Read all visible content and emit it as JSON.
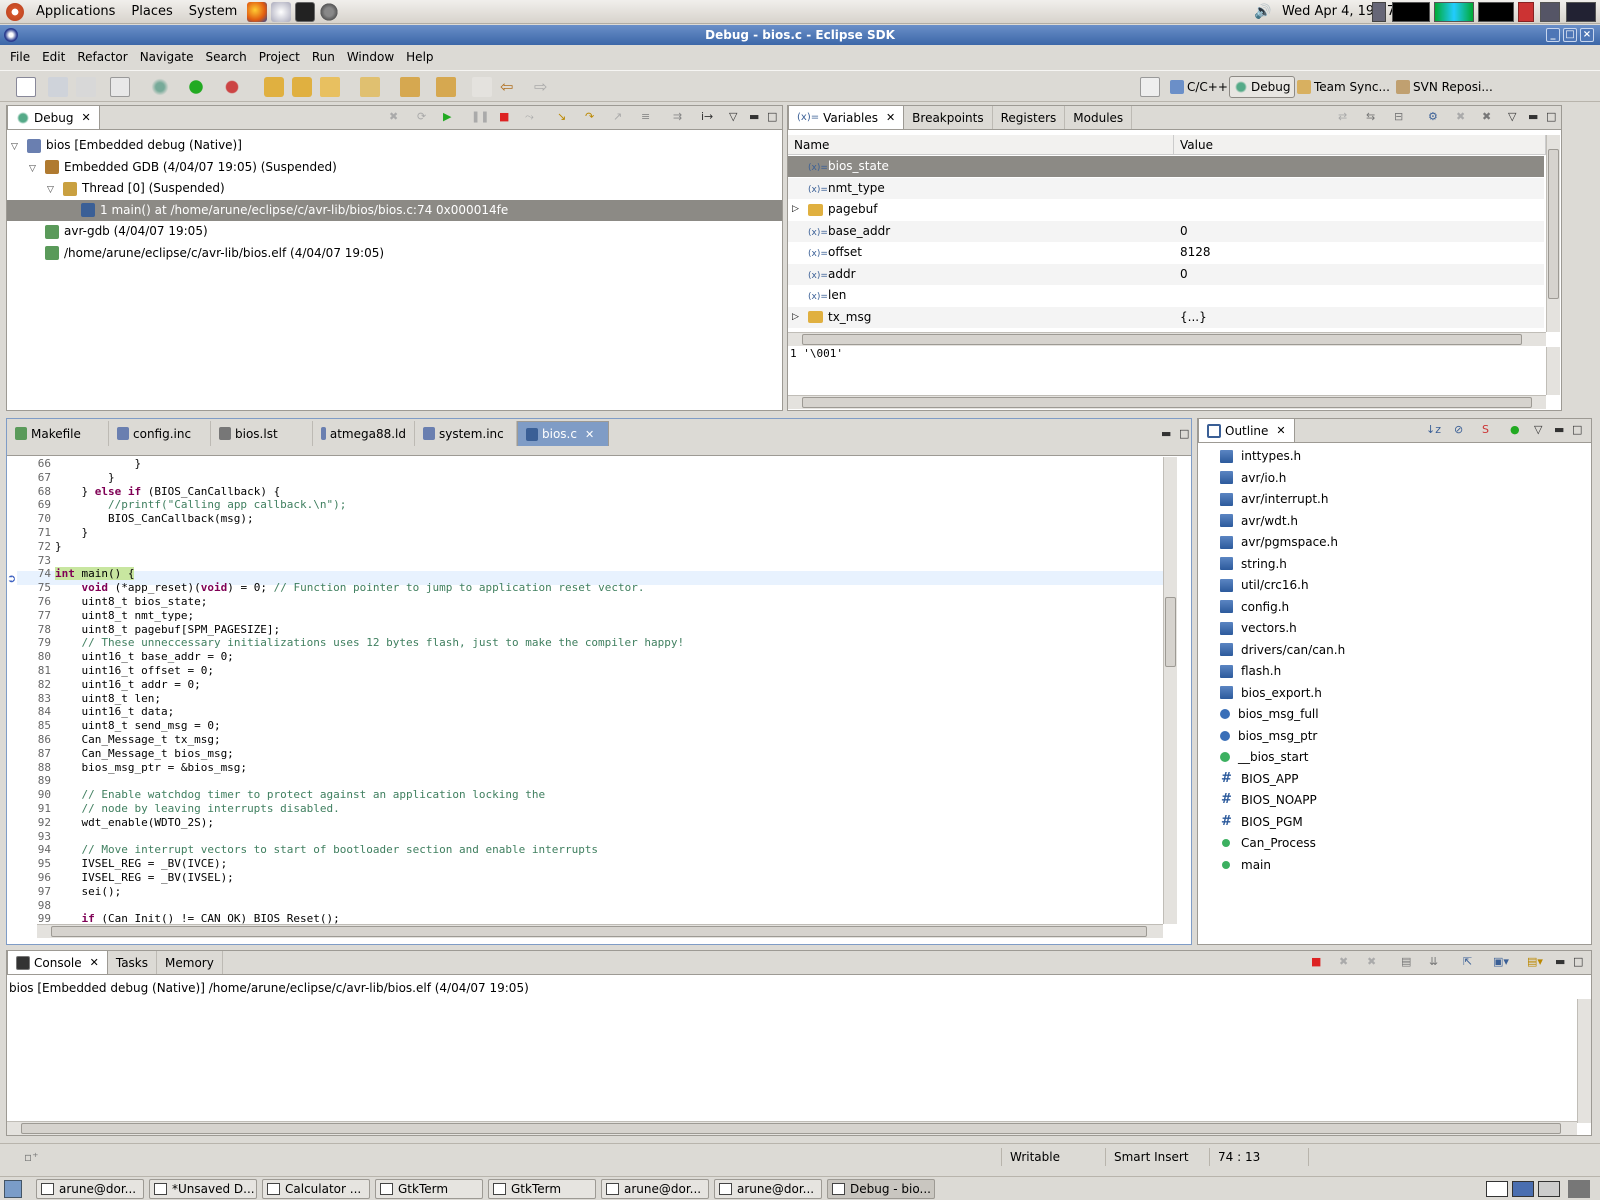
{
  "gnome_panel": {
    "menus": [
      "Applications",
      "Places",
      "System"
    ],
    "clock": "Wed Apr  4, 19:07"
  },
  "window": {
    "title": "Debug - bios.c - Eclipse SDK"
  },
  "menubar": [
    "File",
    "Edit",
    "Refactor",
    "Navigate",
    "Search",
    "Project",
    "Run",
    "Window",
    "Help"
  ],
  "perspectives": [
    {
      "label": "C/C++"
    },
    {
      "label": "Debug"
    },
    {
      "label": "Team Sync..."
    },
    {
      "label": "SVN Reposi..."
    }
  ],
  "debug_view": {
    "tab": "Debug",
    "tree": [
      {
        "text": "bios [Embedded debug (Native)]",
        "indent": 0,
        "expanded": true,
        "icon": "launch-icon"
      },
      {
        "text": "Embedded GDB (4/04/07 19:05) (Suspended)",
        "indent": 1,
        "expanded": true,
        "icon": "debug-target-icon"
      },
      {
        "text": "Thread [0] (Suspended)",
        "indent": 2,
        "expanded": true,
        "icon": "thread-icon"
      },
      {
        "text": "1 main() at /home/arune/eclipse/c/avr-lib/bios/bios.c:74 0x000014fe",
        "indent": 3,
        "selected": true,
        "icon": "stack-frame-icon"
      },
      {
        "text": "avr-gdb (4/04/07 19:05)",
        "indent": 1,
        "icon": "process-icon"
      },
      {
        "text": "/home/arune/eclipse/c/avr-lib/bios.elf (4/04/07 19:05)",
        "indent": 1,
        "icon": "process-icon"
      }
    ]
  },
  "variables_view": {
    "tabs": [
      "Variables",
      "Breakpoints",
      "Registers",
      "Modules"
    ],
    "columns": [
      "Name",
      "Value"
    ],
    "rows": [
      {
        "name": "bios_state",
        "value": "",
        "selected": true
      },
      {
        "name": "nmt_type",
        "value": ""
      },
      {
        "name": "pagebuf",
        "value": "",
        "expandable": true
      },
      {
        "name": "base_addr",
        "value": "0"
      },
      {
        "name": "offset",
        "value": "8128"
      },
      {
        "name": "addr",
        "value": "0"
      },
      {
        "name": "len",
        "value": ""
      },
      {
        "name": "tx_msg",
        "value": "{...}",
        "expandable": true
      }
    ],
    "detail": "1 '\\001'"
  },
  "editor": {
    "tabs": [
      {
        "label": "Makefile"
      },
      {
        "label": "config.inc"
      },
      {
        "label": "bios.lst"
      },
      {
        "label": "atmega88.ld"
      },
      {
        "label": "system.inc"
      },
      {
        "label": "bios.c",
        "active": true
      }
    ],
    "current_line": 74,
    "lines": [
      {
        "n": "66",
        "code": "            }"
      },
      {
        "n": "67",
        "code": "        }"
      },
      {
        "n": "68",
        "code": "    } else if (BIOS_CanCallback) {"
      },
      {
        "n": "69",
        "code": "        //printf(\"Calling app callback.\\n\");"
      },
      {
        "n": "70",
        "code": "        BIOS_CanCallback(msg);"
      },
      {
        "n": "71",
        "code": "    }"
      },
      {
        "n": "72",
        "code": "}"
      },
      {
        "n": "73",
        "code": ""
      },
      {
        "n": "74",
        "code": "int main() {"
      },
      {
        "n": "75",
        "code": "    void (*app_reset)(void) = 0; // Function pointer to jump to application reset vector."
      },
      {
        "n": "76",
        "code": "    uint8_t bios_state;"
      },
      {
        "n": "77",
        "code": "    uint8_t nmt_type;"
      },
      {
        "n": "78",
        "code": "    uint8_t pagebuf[SPM_PAGESIZE];"
      },
      {
        "n": "79",
        "code": "    // These unneccessary initializations uses 12 bytes flash, just to make the compiler happy!"
      },
      {
        "n": "80",
        "code": "    uint16_t base_addr = 0;"
      },
      {
        "n": "81",
        "code": "    uint16_t offset = 0;"
      },
      {
        "n": "82",
        "code": "    uint16_t addr = 0;"
      },
      {
        "n": "83",
        "code": "    uint8_t len;"
      },
      {
        "n": "84",
        "code": "    uint16_t data;"
      },
      {
        "n": "85",
        "code": "    uint8_t send_msg = 0;"
      },
      {
        "n": "86",
        "code": "    Can_Message_t tx_msg;"
      },
      {
        "n": "87",
        "code": "    Can_Message_t bios_msg;"
      },
      {
        "n": "88",
        "code": "    bios_msg_ptr = &bios_msg;"
      },
      {
        "n": "89",
        "code": ""
      },
      {
        "n": "90",
        "code": "    // Enable watchdog timer to protect against an application locking the"
      },
      {
        "n": "91",
        "code": "    // node by leaving interrupts disabled."
      },
      {
        "n": "92",
        "code": "    wdt_enable(WDTO_2S);"
      },
      {
        "n": "93",
        "code": ""
      },
      {
        "n": "94",
        "code": "    // Move interrupt vectors to start of bootloader section and enable interrupts"
      },
      {
        "n": "95",
        "code": "    IVSEL_REG = _BV(IVCE);"
      },
      {
        "n": "96",
        "code": "    IVSEL_REG = _BV(IVSEL);"
      },
      {
        "n": "97",
        "code": "    sei();"
      },
      {
        "n": "98",
        "code": ""
      },
      {
        "n": "99",
        "code": "    if (Can_Init() != CAN_OK) BIOS_Reset();"
      }
    ]
  },
  "outline_view": {
    "tab": "Outline",
    "items": [
      {
        "label": "inttypes.h",
        "kind": "include"
      },
      {
        "label": "avr/io.h",
        "kind": "include"
      },
      {
        "label": "avr/interrupt.h",
        "kind": "include"
      },
      {
        "label": "avr/wdt.h",
        "kind": "include"
      },
      {
        "label": "avr/pgmspace.h",
        "kind": "include"
      },
      {
        "label": "string.h",
        "kind": "include"
      },
      {
        "label": "util/crc16.h",
        "kind": "include"
      },
      {
        "label": "config.h",
        "kind": "include"
      },
      {
        "label": "vectors.h",
        "kind": "include"
      },
      {
        "label": "drivers/can/can.h",
        "kind": "include"
      },
      {
        "label": "flash.h",
        "kind": "include"
      },
      {
        "label": "bios_export.h",
        "kind": "include"
      },
      {
        "label": "bios_msg_full",
        "kind": "variable"
      },
      {
        "label": "bios_msg_ptr",
        "kind": "variable"
      },
      {
        "label": "__bios_start",
        "kind": "variable-green"
      },
      {
        "label": "BIOS_APP",
        "kind": "macro"
      },
      {
        "label": "BIOS_NOAPP",
        "kind": "macro"
      },
      {
        "label": "BIOS_PGM",
        "kind": "macro"
      },
      {
        "label": "Can_Process",
        "kind": "function"
      },
      {
        "label": "main",
        "kind": "function"
      }
    ]
  },
  "console_view": {
    "tabs": [
      "Console",
      "Tasks",
      "Memory"
    ],
    "header": "bios [Embedded debug (Native)] /home/arune/eclipse/c/avr-lib/bios.elf (4/04/07 19:05)"
  },
  "status_bar": {
    "writable": "Writable",
    "insert_mode": "Smart Insert",
    "position": "74 : 13"
  },
  "taskbar": [
    {
      "label": "arune@dor..."
    },
    {
      "label": "*Unsaved D..."
    },
    {
      "label": "Calculator ..."
    },
    {
      "label": "GtkTerm"
    },
    {
      "label": "GtkTerm"
    },
    {
      "label": "arune@dor..."
    },
    {
      "label": "arune@dor..."
    },
    {
      "label": "Debug - bio...",
      "active": true
    }
  ]
}
